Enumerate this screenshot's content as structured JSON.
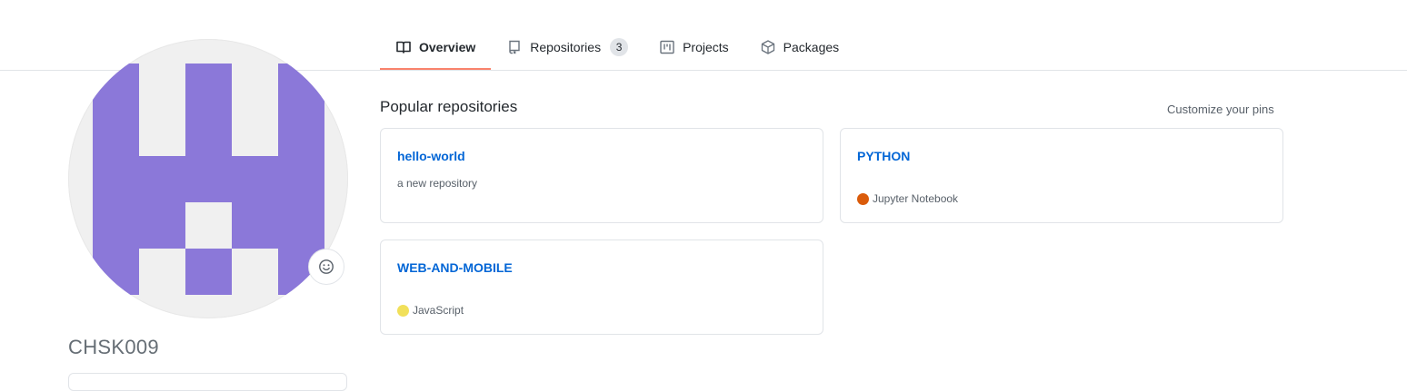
{
  "tabs": [
    {
      "label": "Overview",
      "icon": "book-icon",
      "selected": true
    },
    {
      "label": "Repositories",
      "icon": "repo-icon",
      "count": "3"
    },
    {
      "label": "Projects",
      "icon": "project-icon"
    },
    {
      "label": "Packages",
      "icon": "package-icon"
    }
  ],
  "profile": {
    "username": "CHSK009",
    "avatar_color": "#8b78d9",
    "status_icon": "smiley-icon"
  },
  "popular": {
    "title": "Popular repositories",
    "customize_label": "Customize your pins",
    "repos": [
      {
        "name": "hello-world",
        "description": "a new repository"
      },
      {
        "name": "PYTHON",
        "language": "Jupyter Notebook",
        "language_color": "#DA5B0B"
      },
      {
        "name": "WEB-AND-MOBILE",
        "language": "JavaScript",
        "language_color": "#f1e05a"
      }
    ]
  }
}
